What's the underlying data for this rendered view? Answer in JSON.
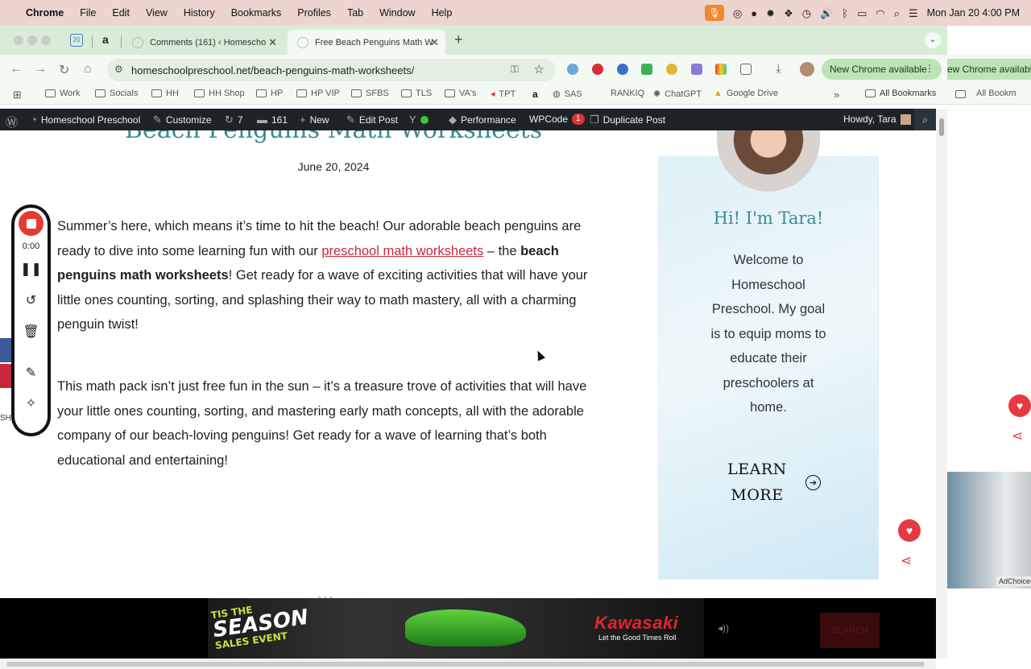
{
  "macos_menubar": {
    "app": "Chrome",
    "menus": [
      "File",
      "Edit",
      "View",
      "History",
      "Bookmarks",
      "Profiles",
      "Tab",
      "Window",
      "Help"
    ],
    "datetime": "Mon Jan 20  4:00 PM"
  },
  "tabs": [
    {
      "title": "Comments (161) ‹ Homescho",
      "active": false
    },
    {
      "title": "Free Beach Penguins Math W",
      "active": true
    }
  ],
  "toolbar": {
    "url": "homeschoolpreschool.net/beach-penguins-math-worksheets/",
    "new_chrome_label": "New Chrome available",
    "overflow_chrome_label": "ew Chrome available"
  },
  "bookmarks": [
    "Work",
    "Socials",
    "HH",
    "HH Shop",
    "HP",
    "HP VIP",
    "SFBS",
    "TLS",
    "VA's",
    "TPT",
    "SAS",
    "RANKIQ",
    "ChatGPT",
    "Google Drive"
  ],
  "all_bookmarks": "All Bookmarks",
  "all_bookmarks_overflow": "All Bookm",
  "wp_admin_bar": {
    "site": "Homeschool Preschool",
    "customize": "Customize",
    "updates": "7",
    "comments": "161",
    "new": "New",
    "edit_post": "Edit Post",
    "performance": "Performance",
    "wpcode": "WPCode",
    "wpcode_badge": "1",
    "duplicate": "Duplicate Post",
    "howdy": "Howdy, Tara"
  },
  "post": {
    "title": "Beach Penguins Math Worksheets",
    "date": "June 20, 2024",
    "p1_a": "Summer’s here, which means it’s time to hit the beach! Our adorable beach penguins are ready to dive into some learning fun with our ",
    "p1_link": "preschool math worksheets",
    "p1_b": " – the ",
    "p1_bold": "beach penguins math worksheets",
    "p1_c": "! Get ready for a wave of exciting activities that will have your little ones counting, sorting, and splashing their way to math mastery, all with a charming penguin twist!",
    "p2": "This math pack isn’t just free fun in the sun – it’s a treasure trove of activities that will have your little ones counting, sorting, and mastering early math concepts, all with the adorable company of our beach-loving penguins! Get ready for a wave of learning that’s both educational and entertaining!"
  },
  "sidebar": {
    "greeting": "Hi! I'm Tara!",
    "welcome": "Welcome to Homeschool Preschool. My goal is to equip moms to educate their preschoolers at home.",
    "cta": "LEARN MORE"
  },
  "recorder": {
    "time": "0:00"
  },
  "share_edge_label": "SH",
  "ad": {
    "line1": "TIS THE",
    "line2": "SEASON",
    "line3": "SALES EVENT",
    "brand": "Kawasaki",
    "tagline": "Let the Good Times Roll",
    "search": "SEARCH"
  },
  "adchoices": "AdChoices",
  "colors": {
    "accent_teal": "#3a8c91",
    "link_red": "#c8283b",
    "wp_bar": "#1d2327",
    "menubar": "#ecd5cf",
    "tabstrip": "#d9ecd7"
  }
}
